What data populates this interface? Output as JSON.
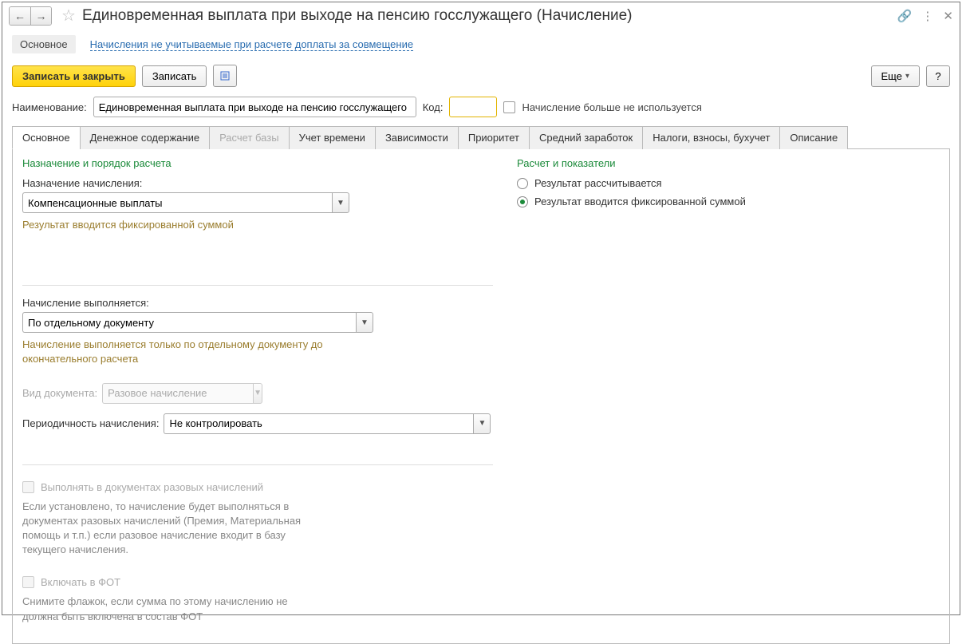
{
  "title": "Единовременная выплата при выходе на пенсию госслужащего (Начисление)",
  "subnav": {
    "main": "Основное",
    "link": "Начисления не учитываемые при расчете доплаты за совмещение"
  },
  "toolbar": {
    "save_close": "Записать и закрыть",
    "save": "Записать",
    "more": "Еще",
    "help": "?"
  },
  "header": {
    "name_label": "Наименование:",
    "name_value": "Единовременная выплата при выходе на пенсию госслужащего",
    "code_label": "Код:",
    "code_value": "",
    "unused_label": "Начисление больше не используется"
  },
  "tabs": {
    "t0": "Основное",
    "t1": "Денежное содержание",
    "t2": "Расчет базы",
    "t3": "Учет времени",
    "t4": "Зависимости",
    "t5": "Приоритет",
    "t6": "Средний заработок",
    "t7": "Налоги, взносы, бухучет",
    "t8": "Описание"
  },
  "left": {
    "section": "Назначение и порядок расчета",
    "assign_label": "Назначение начисления:",
    "assign_value": "Компенсационные выплаты",
    "assign_hint": "Результат вводится фиксированной суммой",
    "exec_label": "Начисление выполняется:",
    "exec_value": "По отдельному документу",
    "exec_hint": "Начисление выполняется только по отдельному документу до окончательного расчета",
    "doc_label": "Вид документа:",
    "doc_value": "Разовое начисление",
    "period_label": "Периодичность начисления:",
    "period_value": "Не контролировать",
    "chk1_label": "Выполнять в документах разовых начислений",
    "chk1_hint": "Если установлено, то начисление будет выполняться в документах разовых начислений (Премия, Материальная помощь и т.п.) если разовое начисление входит в базу текущего начисления.",
    "chk2_label": "Включать в ФОТ",
    "chk2_hint": "Снимите флажок, если сумма по этому начислению не должна быть включена в состав ФОТ"
  },
  "right": {
    "section": "Расчет и показатели",
    "r1": "Результат рассчитывается",
    "r2": "Результат вводится фиксированной суммой"
  }
}
